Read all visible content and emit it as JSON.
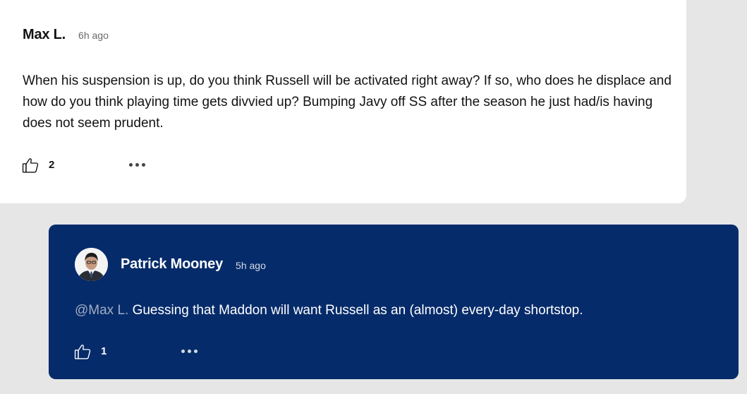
{
  "comment": {
    "author": "Max L.",
    "time": "6h ago",
    "body": "When his suspension is up, do you think Russell will be activated right away? If so, who does he displace and how do you think playing time gets divvied up? Bumping Javy off SS after the season he just had/is having does not seem prudent.",
    "like_count": "2",
    "like_icon": "thumbs-up-icon",
    "more_icon": "more-options-icon"
  },
  "reply": {
    "author": "Patrick Mooney",
    "time": "5h ago",
    "mention": "@Max L.",
    "body": " Guessing that Maddon will want Russell as an (almost) every-day shortstop.",
    "like_count": "1",
    "like_icon": "thumbs-up-icon",
    "more_icon": "more-options-icon"
  },
  "colors": {
    "page_background": "#e6e6e6",
    "comment_background": "#ffffff",
    "reply_background": "#052b6a",
    "mention_color": "#a2adc4"
  }
}
